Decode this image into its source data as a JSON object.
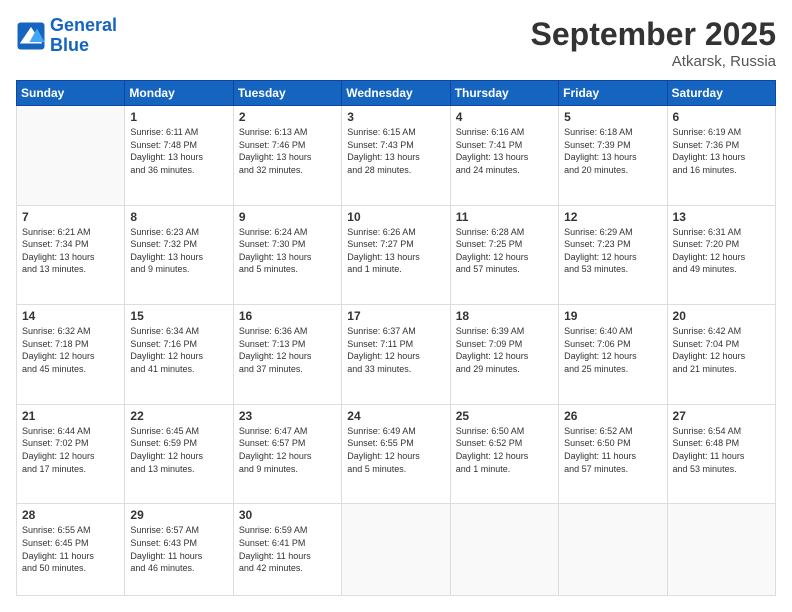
{
  "header": {
    "logo_line1": "General",
    "logo_line2": "Blue",
    "month": "September 2025",
    "location": "Atkarsk, Russia"
  },
  "weekdays": [
    "Sunday",
    "Monday",
    "Tuesday",
    "Wednesday",
    "Thursday",
    "Friday",
    "Saturday"
  ],
  "weeks": [
    [
      {
        "day": "",
        "info": ""
      },
      {
        "day": "1",
        "info": "Sunrise: 6:11 AM\nSunset: 7:48 PM\nDaylight: 13 hours\nand 36 minutes."
      },
      {
        "day": "2",
        "info": "Sunrise: 6:13 AM\nSunset: 7:46 PM\nDaylight: 13 hours\nand 32 minutes."
      },
      {
        "day": "3",
        "info": "Sunrise: 6:15 AM\nSunset: 7:43 PM\nDaylight: 13 hours\nand 28 minutes."
      },
      {
        "day": "4",
        "info": "Sunrise: 6:16 AM\nSunset: 7:41 PM\nDaylight: 13 hours\nand 24 minutes."
      },
      {
        "day": "5",
        "info": "Sunrise: 6:18 AM\nSunset: 7:39 PM\nDaylight: 13 hours\nand 20 minutes."
      },
      {
        "day": "6",
        "info": "Sunrise: 6:19 AM\nSunset: 7:36 PM\nDaylight: 13 hours\nand 16 minutes."
      }
    ],
    [
      {
        "day": "7",
        "info": ""
      },
      {
        "day": "8",
        "info": "Sunrise: 6:23 AM\nSunset: 7:32 PM\nDaylight: 13 hours\nand 9 minutes."
      },
      {
        "day": "9",
        "info": "Sunrise: 6:24 AM\nSunset: 7:30 PM\nDaylight: 13 hours\nand 5 minutes."
      },
      {
        "day": "10",
        "info": "Sunrise: 6:26 AM\nSunset: 7:27 PM\nDaylight: 13 hours\nand 1 minute."
      },
      {
        "day": "11",
        "info": "Sunrise: 6:28 AM\nSunset: 7:25 PM\nDaylight: 12 hours\nand 57 minutes."
      },
      {
        "day": "12",
        "info": "Sunrise: 6:29 AM\nSunset: 7:23 PM\nDaylight: 12 hours\nand 53 minutes."
      },
      {
        "day": "13",
        "info": "Sunrise: 6:31 AM\nSunset: 7:20 PM\nDaylight: 12 hours\nand 49 minutes."
      }
    ],
    [
      {
        "day": "14",
        "info": "Sunrise: 6:32 AM\nSunset: 7:18 PM\nDaylight: 12 hours\nand 45 minutes."
      },
      {
        "day": "15",
        "info": "Sunrise: 6:34 AM\nSunset: 7:16 PM\nDaylight: 12 hours\nand 41 minutes."
      },
      {
        "day": "16",
        "info": "Sunrise: 6:36 AM\nSunset: 7:13 PM\nDaylight: 12 hours\nand 37 minutes."
      },
      {
        "day": "17",
        "info": "Sunrise: 6:37 AM\nSunset: 7:11 PM\nDaylight: 12 hours\nand 33 minutes."
      },
      {
        "day": "18",
        "info": "Sunrise: 6:39 AM\nSunset: 7:09 PM\nDaylight: 12 hours\nand 29 minutes."
      },
      {
        "day": "19",
        "info": "Sunrise: 6:40 AM\nSunset: 7:06 PM\nDaylight: 12 hours\nand 25 minutes."
      },
      {
        "day": "20",
        "info": "Sunrise: 6:42 AM\nSunset: 7:04 PM\nDaylight: 12 hours\nand 21 minutes."
      }
    ],
    [
      {
        "day": "21",
        "info": "Sunrise: 6:44 AM\nSunset: 7:02 PM\nDaylight: 12 hours\nand 17 minutes."
      },
      {
        "day": "22",
        "info": "Sunrise: 6:45 AM\nSunset: 6:59 PM\nDaylight: 12 hours\nand 13 minutes."
      },
      {
        "day": "23",
        "info": "Sunrise: 6:47 AM\nSunset: 6:57 PM\nDaylight: 12 hours\nand 9 minutes."
      },
      {
        "day": "24",
        "info": "Sunrise: 6:49 AM\nSunset: 6:55 PM\nDaylight: 12 hours\nand 5 minutes."
      },
      {
        "day": "25",
        "info": "Sunrise: 6:50 AM\nSunset: 6:52 PM\nDaylight: 12 hours\nand 1 minute."
      },
      {
        "day": "26",
        "info": "Sunrise: 6:52 AM\nSunset: 6:50 PM\nDaylight: 11 hours\nand 57 minutes."
      },
      {
        "day": "27",
        "info": "Sunrise: 6:54 AM\nSunset: 6:48 PM\nDaylight: 11 hours\nand 53 minutes."
      }
    ],
    [
      {
        "day": "28",
        "info": "Sunrise: 6:55 AM\nSunset: 6:45 PM\nDaylight: 11 hours\nand 50 minutes."
      },
      {
        "day": "29",
        "info": "Sunrise: 6:57 AM\nSunset: 6:43 PM\nDaylight: 11 hours\nand 46 minutes."
      },
      {
        "day": "30",
        "info": "Sunrise: 6:59 AM\nSunset: 6:41 PM\nDaylight: 11 hours\nand 42 minutes."
      },
      {
        "day": "",
        "info": ""
      },
      {
        "day": "",
        "info": ""
      },
      {
        "day": "",
        "info": ""
      },
      {
        "day": "",
        "info": ""
      }
    ]
  ],
  "week7_sunday_info": "Sunrise: 6:21 AM\nSunset: 7:34 PM\nDaylight: 13 hours\nand 13 minutes."
}
